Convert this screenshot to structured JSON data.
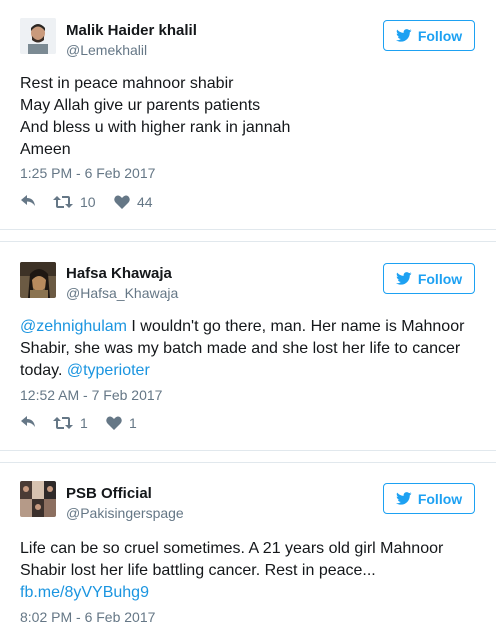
{
  "tweets": [
    {
      "name": "Malik Haider khalil",
      "handle": "@Lemekhalil",
      "follow_label": "Follow",
      "lines": [
        "Rest in peace mahnoor shabir",
        "May Allah give ur parents patients",
        "And bless u with higher rank in jannah",
        "Ameen"
      ],
      "time": "1:25 PM - 6 Feb 2017",
      "retweets": "10",
      "likes": "44"
    },
    {
      "name": "Hafsa Khawaja",
      "handle": "@Hafsa_Khawaja",
      "follow_label": "Follow",
      "mention1": "@zehnighulam",
      "text_line1_rest": " I wouldn't go there, man. Her name is Mahnoor",
      "text_line2": "Shabir, she was my batch made and she lost her life to cancer",
      "text_line3_pre": "today. ",
      "mention2": "@typerioter",
      "time": "12:52 AM - 7 Feb 2017",
      "retweets": "1",
      "likes": "1"
    },
    {
      "name": "PSB Official",
      "handle": "@Pakisingerspage",
      "follow_label": "Follow",
      "text_line1": "Life can be so cruel sometimes. A 21 years old girl Mahnoor",
      "text_line2": "Shabir lost her life battling cancer. Rest in peace...",
      "link": "fb.me/8yVYBuhg9",
      "time": "8:02 PM - 6 Feb 2017"
    }
  ],
  "colors": {
    "accent": "#1da1f2",
    "link": "#1b95e0",
    "muted": "#657786",
    "separator": "#e1e8ed"
  },
  "icons": [
    "twitter-bird-icon",
    "reply-icon",
    "retweet-icon",
    "heart-icon"
  ]
}
